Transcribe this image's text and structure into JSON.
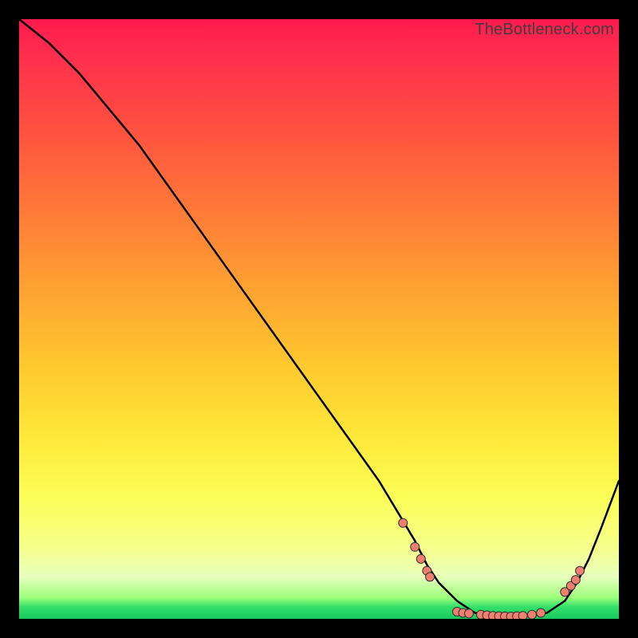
{
  "watermark": "TheBottleneck.com",
  "colors": {
    "frame": "#000000",
    "line": "#000000",
    "dot_fill": "#ef7f70",
    "dot_stroke": "#303030"
  },
  "chart_data": {
    "type": "line",
    "title": "",
    "xlabel": "",
    "ylabel": "",
    "xlim": [
      0,
      100
    ],
    "ylim": [
      0,
      100
    ],
    "series": [
      {
        "name": "curve",
        "x": [
          0,
          5,
          10,
          15,
          20,
          25,
          30,
          35,
          40,
          45,
          50,
          55,
          60,
          63,
          66,
          68,
          70,
          73,
          76,
          79,
          82,
          85,
          88,
          91,
          93,
          95,
          97,
          100
        ],
        "y": [
          100,
          96,
          91,
          85,
          79,
          72,
          65,
          58,
          51,
          44,
          37,
          30,
          23,
          18,
          13,
          9,
          6,
          3,
          1,
          0.5,
          0.4,
          0.5,
          1,
          3,
          6,
          10,
          15,
          23
        ]
      }
    ],
    "markers": [
      {
        "x": 64,
        "y": 16
      },
      {
        "x": 66,
        "y": 12
      },
      {
        "x": 67,
        "y": 10
      },
      {
        "x": 68,
        "y": 8
      },
      {
        "x": 68.5,
        "y": 7
      },
      {
        "x": 73,
        "y": 1.2
      },
      {
        "x": 74,
        "y": 1.0
      },
      {
        "x": 75,
        "y": 0.9
      },
      {
        "x": 77,
        "y": 0.7
      },
      {
        "x": 78,
        "y": 0.6
      },
      {
        "x": 79,
        "y": 0.5
      },
      {
        "x": 80,
        "y": 0.45
      },
      {
        "x": 81,
        "y": 0.42
      },
      {
        "x": 82,
        "y": 0.4
      },
      {
        "x": 83,
        "y": 0.45
      },
      {
        "x": 84,
        "y": 0.5
      },
      {
        "x": 85.5,
        "y": 0.7
      },
      {
        "x": 87,
        "y": 1.0
      },
      {
        "x": 91,
        "y": 4.5
      },
      {
        "x": 92,
        "y": 5.5
      },
      {
        "x": 92.8,
        "y": 6.5
      },
      {
        "x": 93.5,
        "y": 8
      }
    ],
    "notes": "Axes unlabeled in source image; x and y normalized 0–100. Curve descends steeply from top-left, reaches a flat valley near x≈78–85 at y≈0, then rises toward bottom-right. Values are estimated from pixel positions."
  }
}
